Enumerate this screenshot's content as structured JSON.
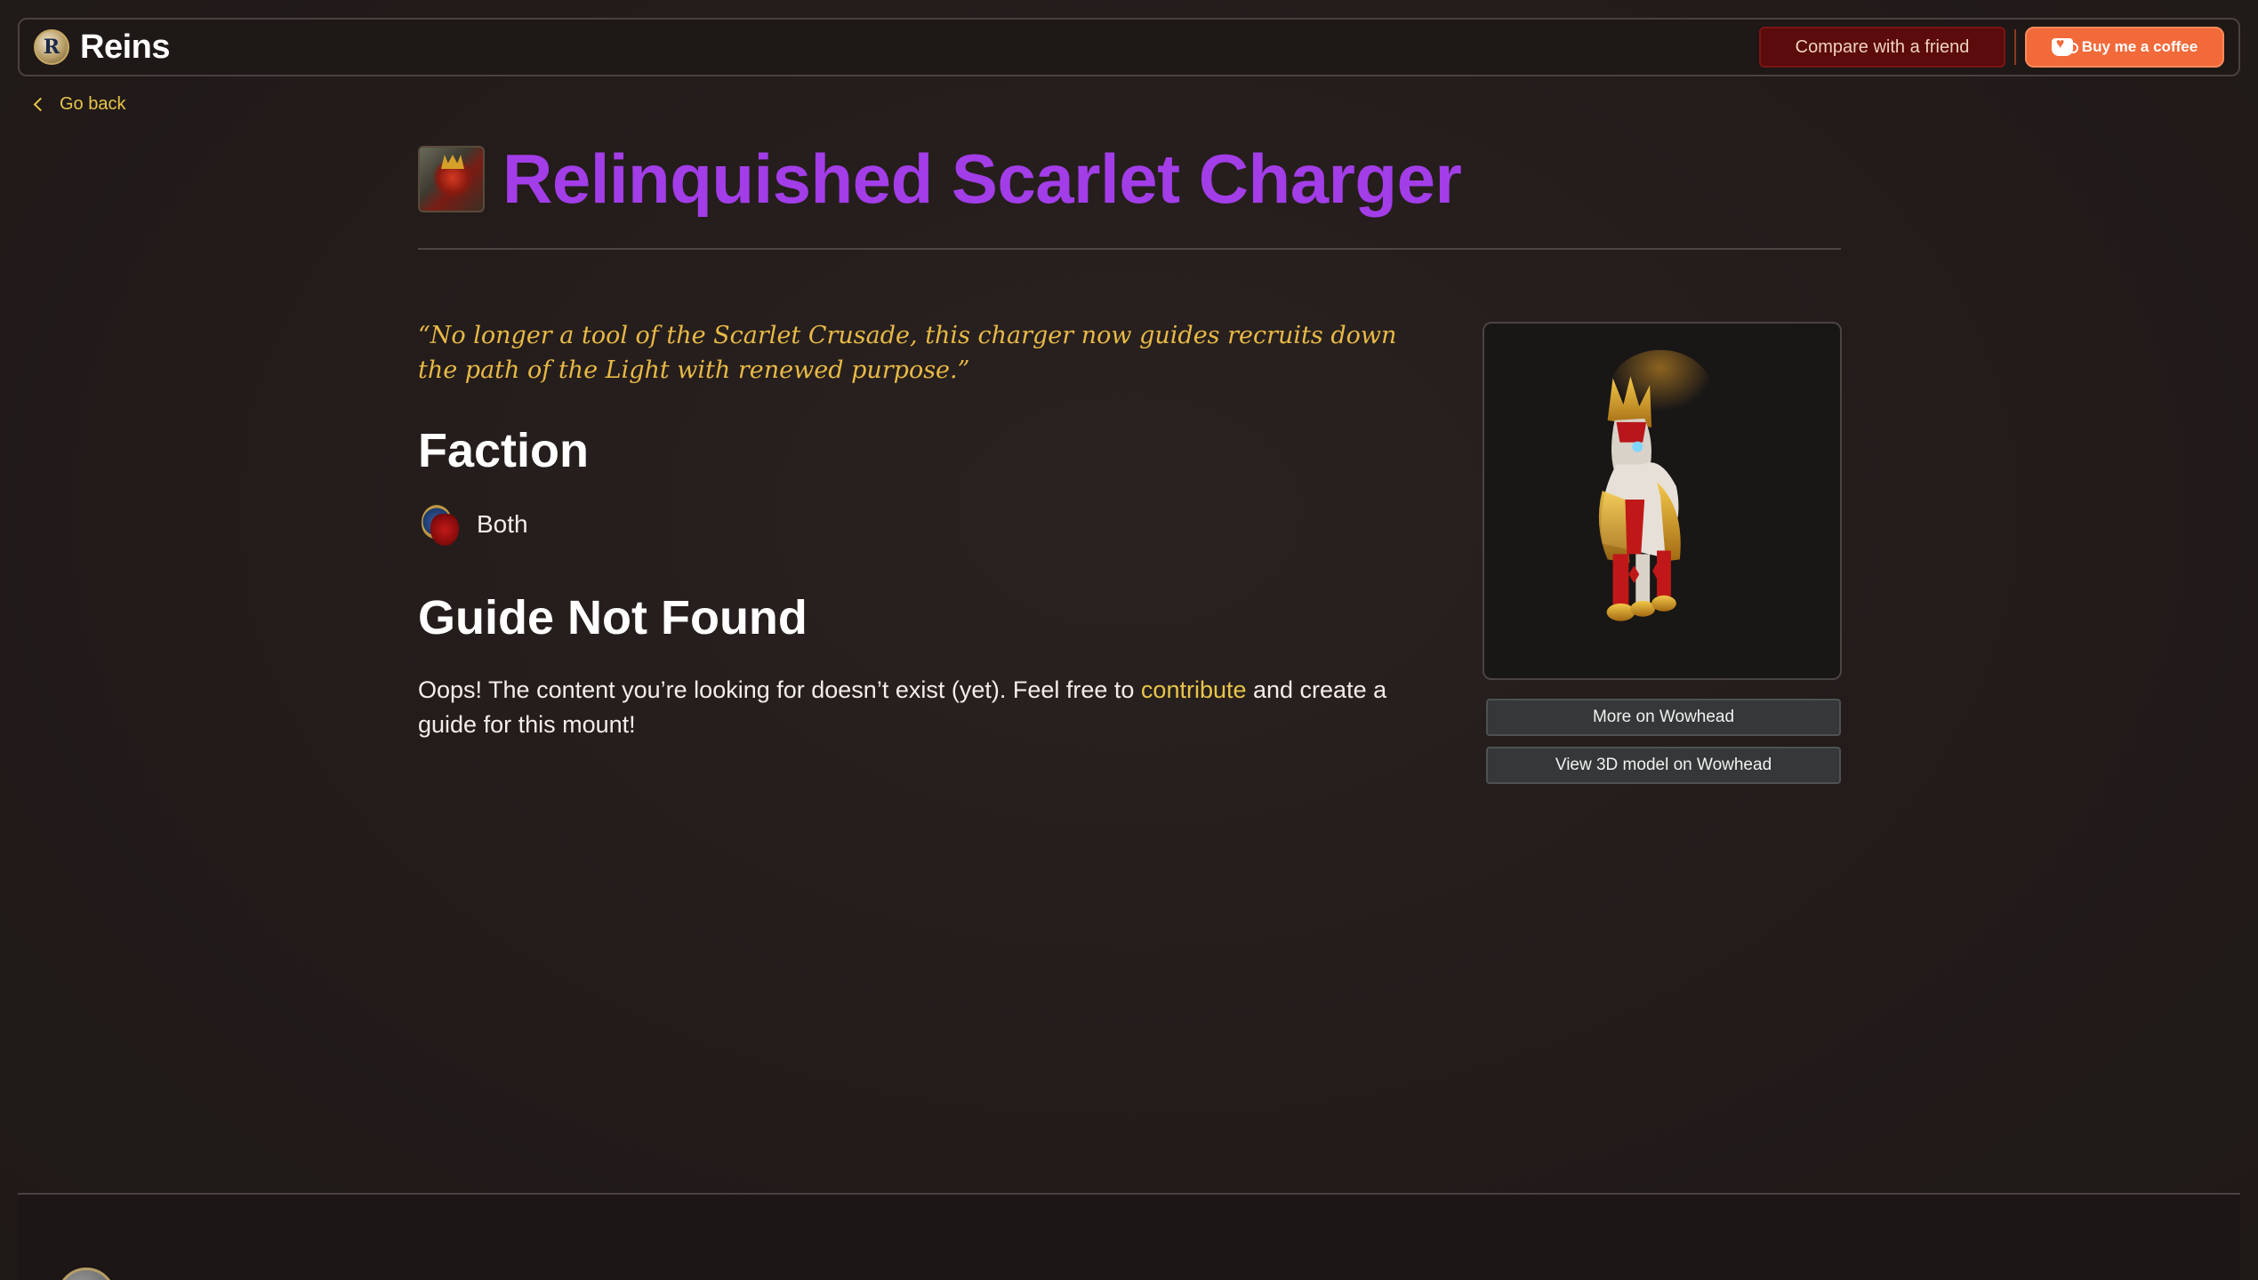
{
  "header": {
    "logo_letter": "R",
    "app_name": "Reins",
    "compare_label": "Compare with a friend",
    "coffee_label": "Buy me a coffee"
  },
  "nav": {
    "go_back_label": "Go back"
  },
  "mount": {
    "title": "Relinquished Scarlet Charger",
    "title_color": "#a23de8",
    "quote": "“No longer a tool of the Scarlet Crusade, this charger now guides recruits down the path of the Light with renewed purpose.”"
  },
  "faction": {
    "heading": "Faction",
    "value": "Both"
  },
  "guide": {
    "heading": "Guide Not Found",
    "text_before": "Oops! The content you’re looking for doesn’t exist (yet). Feel free to ",
    "link_label": "contribute",
    "text_after": " and create a guide for this mount!"
  },
  "side": {
    "wowhead_label": "More on Wowhead",
    "model_label": "View 3D model on Wowhead"
  },
  "colors": {
    "accent_gold": "#e8c54a",
    "compare_bg": "#5b0b0b",
    "coffee_bg": "#f26a3a"
  }
}
